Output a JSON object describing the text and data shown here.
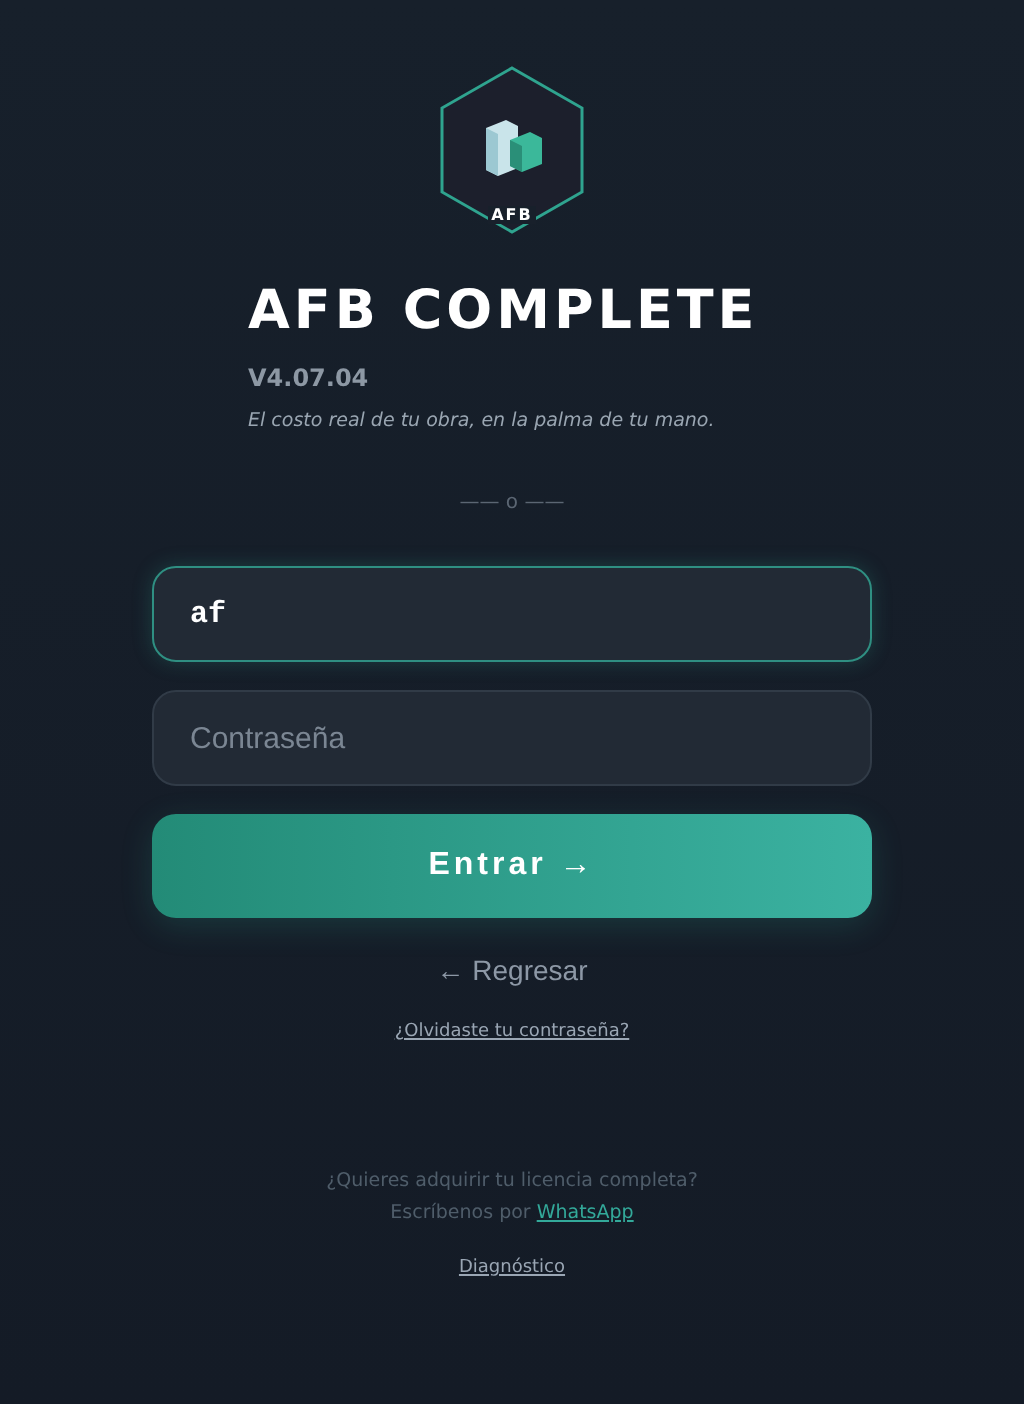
{
  "logo": {
    "label": "AFB"
  },
  "title": "AFB COMPLETE",
  "version": "V4.07.04",
  "tagline": "El costo real de tu obra, en la palma de tu mano.",
  "divider": "—— o ——",
  "username": {
    "value": "af",
    "focused": true
  },
  "password": {
    "placeholder": "Contraseña"
  },
  "submit": "Entrar →",
  "back": "← Regresar",
  "forgot": "¿Olvidaste tu contraseña?",
  "license": {
    "line_1": "¿Quieres adquirir tu licencia completa?",
    "line_2": "Escríbenos por",
    "link": "WhatsApp"
  },
  "diagnostics": "Diagnóstico"
}
